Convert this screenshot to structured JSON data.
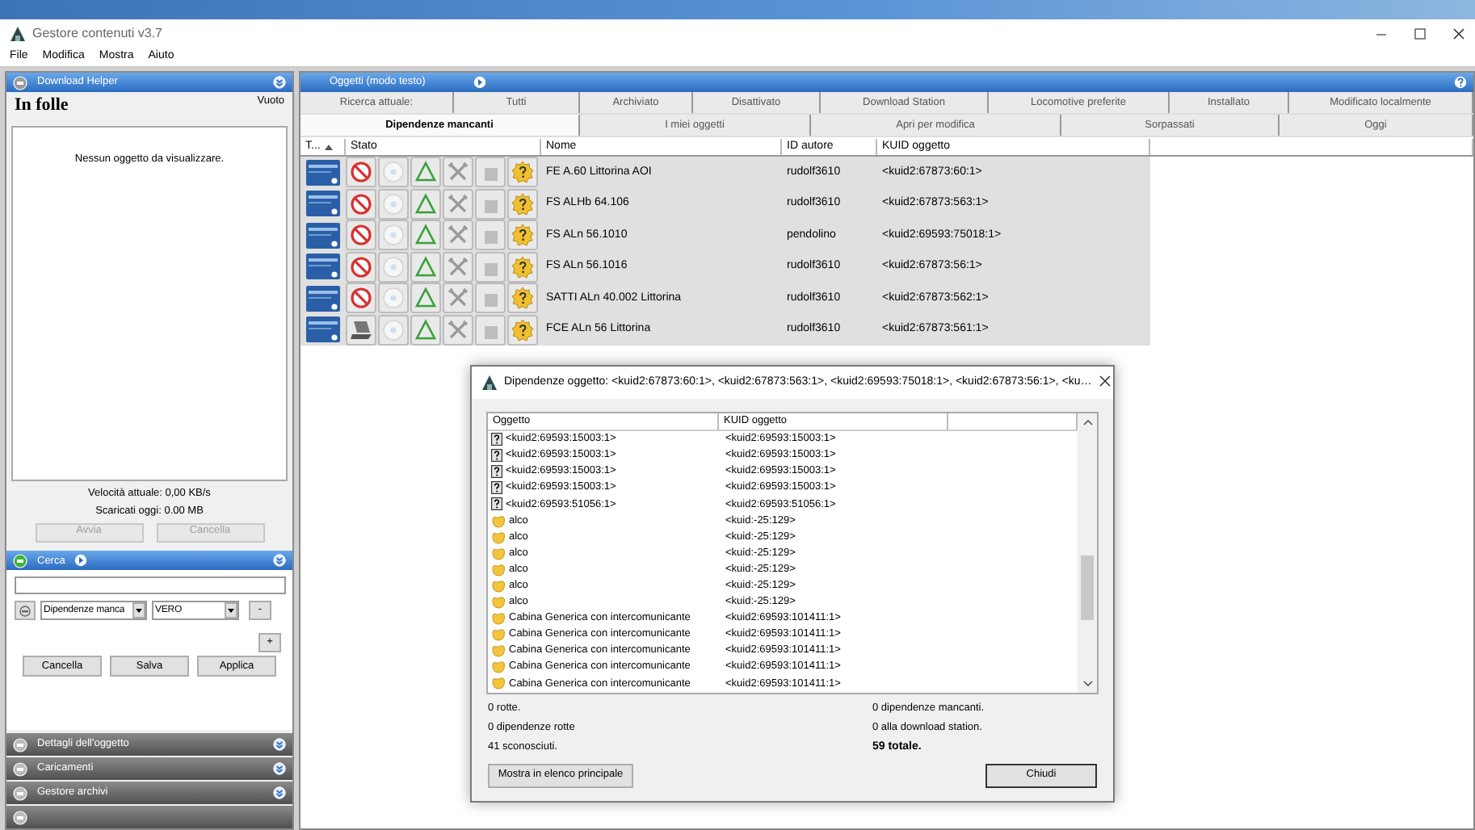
{
  "window": {
    "title": "Gestore contenuti v3.7"
  },
  "menu": [
    "File",
    "Modifica",
    "Mostra",
    "Aiuto"
  ],
  "download_helper": {
    "title": "Download Helper",
    "state": "In folle",
    "queue_status": "Vuoto",
    "empty_message": "Nessun oggetto da visualizzare.",
    "speed": "Velocità attuale: 0,00 KB/s",
    "downloaded_today": "Scaricati oggi: 0.00 MB",
    "buttons": [
      {
        "label": "Avvia",
        "disabled": true
      },
      {
        "label": "Cancella",
        "disabled": true
      }
    ]
  },
  "search_panel": {
    "title": "Cerca",
    "filter_field": "Dipendenze manca",
    "value_field": "VERO",
    "remove_button": "-",
    "add_button": "+",
    "buttons": [
      "Cancella",
      "Salva",
      "Applica"
    ]
  },
  "collapsed_panels": [
    "Dettagli dell'oggetto",
    "Caricamenti",
    "Gestore archivi"
  ],
  "objects_panel": {
    "title": "Oggetti (modo testo)",
    "tab_rows": [
      [
        {
          "label": "Ricerca attuale:",
          "selected": false
        },
        {
          "label": "Tutti",
          "selected": false
        },
        {
          "label": "Archiviato",
          "selected": false
        },
        {
          "label": "Disattivato",
          "selected": false
        },
        {
          "label": "Download Station",
          "selected": false
        },
        {
          "label": "Locomotive preferite",
          "selected": false
        },
        {
          "label": "Installato",
          "selected": false
        },
        {
          "label": "Modificato localmente",
          "selected": false
        }
      ],
      [
        {
          "label": "Dipendenze mancanti",
          "selected": true
        },
        {
          "label": "I miei oggetti",
          "selected": false
        },
        {
          "label": "Apri per modifica",
          "selected": false
        },
        {
          "label": "Sorpassati",
          "selected": false
        },
        {
          "label": "Oggi",
          "selected": false
        }
      ]
    ],
    "table": {
      "columns": [
        "T...",
        "Stato",
        "Nome",
        "ID autore",
        "KUID oggetto"
      ],
      "rows": [
        {
          "kind": "faulty",
          "name": "FE A.60 Littorina AOI",
          "author": "rudolf3610",
          "kuid": "<kuid2:67873:60:1>"
        },
        {
          "kind": "faulty",
          "name": "FS ALHb 64.106",
          "author": "rudolf3610",
          "kuid": "<kuid2:67873:563:1>"
        },
        {
          "kind": "faulty",
          "name": "FS ALn 56.1010",
          "author": "pendolino",
          "kuid": "<kuid2:69593:75018:1>"
        },
        {
          "kind": "faulty",
          "name": "FS ALn 56.1016",
          "author": "rudolf3610",
          "kuid": "<kuid2:67873:56:1>"
        },
        {
          "kind": "faulty",
          "name": "SATTI ALn 40.002 Littorina",
          "author": "rudolf3610",
          "kuid": "<kuid2:67873:562:1>"
        },
        {
          "kind": "local",
          "name": "FCE ALn 56 Littorina",
          "author": "rudolf3610",
          "kuid": "<kuid2:67873:561:1>"
        }
      ]
    }
  },
  "dialog": {
    "title": "Dipendenze oggetto: <kuid2:67873:60:1>, <kuid2:67873:563:1>, <kuid2:69593:75018:1>, <kuid2:67873:56:1>, <ku…",
    "columns": [
      "Oggetto",
      "KUID oggetto"
    ],
    "rows": [
      {
        "kind": "unknown",
        "name": "<kuid2:69593:15003:1>",
        "kuid": "<kuid2:69593:15003:1>"
      },
      {
        "kind": "unknown",
        "name": "<kuid2:69593:15003:1>",
        "kuid": "<kuid2:69593:15003:1>"
      },
      {
        "kind": "unknown",
        "name": "<kuid2:69593:15003:1>",
        "kuid": "<kuid2:69593:15003:1>"
      },
      {
        "kind": "unknown",
        "name": "<kuid2:69593:15003:1>",
        "kuid": "<kuid2:69593:15003:1>"
      },
      {
        "kind": "unknown",
        "name": "<kuid2:69593:51056:1>",
        "kuid": "<kuid2:69593:51056:1>"
      },
      {
        "kind": "asset",
        "name": "alco",
        "kuid": "<kuid:-25:129>"
      },
      {
        "kind": "asset",
        "name": "alco",
        "kuid": "<kuid:-25:129>"
      },
      {
        "kind": "asset",
        "name": "alco",
        "kuid": "<kuid:-25:129>"
      },
      {
        "kind": "asset",
        "name": "alco",
        "kuid": "<kuid:-25:129>"
      },
      {
        "kind": "asset",
        "name": "alco",
        "kuid": "<kuid:-25:129>"
      },
      {
        "kind": "asset",
        "name": "alco",
        "kuid": "<kuid:-25:129>"
      },
      {
        "kind": "asset",
        "name": "Cabina Generica con intercomunicante",
        "kuid": "<kuid2:69593:101411:1>"
      },
      {
        "kind": "asset",
        "name": "Cabina Generica con intercomunicante",
        "kuid": "<kuid2:69593:101411:1>"
      },
      {
        "kind": "asset",
        "name": "Cabina Generica con intercomunicante",
        "kuid": "<kuid2:69593:101411:1>"
      },
      {
        "kind": "asset",
        "name": "Cabina Generica con intercomunicante",
        "kuid": "<kuid2:69593:101411:1>"
      },
      {
        "kind": "asset",
        "name": "Cabina Generica con intercomunicante",
        "kuid": "<kuid2:69593:101411:1>"
      }
    ],
    "stats_left": [
      "0 rotte.",
      "0 dipendenze rotte",
      "41 sconosciuti."
    ],
    "stats_right": [
      "0 dipendenze mancanti.",
      "0 alla download station."
    ],
    "total": "59 totale.",
    "buttons": [
      "Mostra in elenco principale",
      "Chiudi"
    ]
  }
}
